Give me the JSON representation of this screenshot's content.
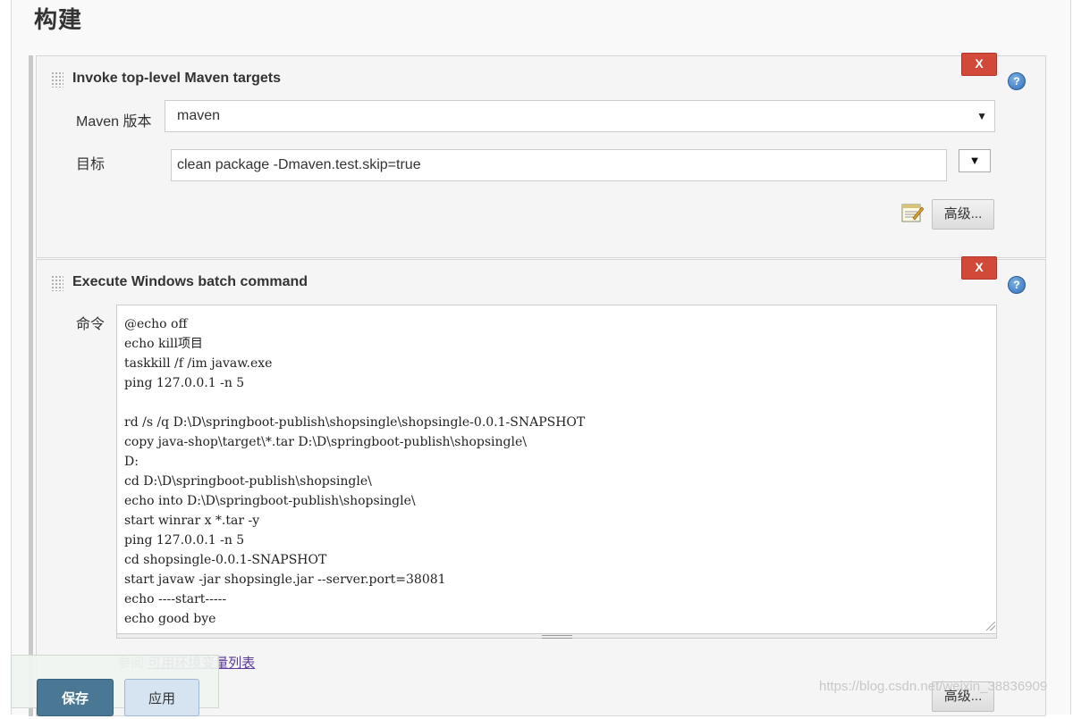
{
  "section": {
    "title": "构建"
  },
  "steps": [
    {
      "title": "Invoke top-level Maven targets",
      "delete_label": "X",
      "help_label": "?",
      "maven_version_label": "Maven 版本",
      "maven_version_value": "maven",
      "select_arrow": "▼",
      "goals_label": "目标",
      "goals_value": "clean package -Dmaven.test.skip=true",
      "expand_label": "▼",
      "advanced_label": "高级..."
    },
    {
      "title": "Execute Windows batch command",
      "delete_label": "X",
      "help_label": "?",
      "command_label": "命令",
      "command_value": "@echo off\necho kill项目\ntaskkill /f /im javaw.exe\nping 127.0.0.1 -n 5\n\nrd /s /q D:\\D\\springboot-publish\\shopsingle\\shopsingle-0.0.1-SNAPSHOT\ncopy java-shop\\target\\*.tar D:\\D\\springboot-publish\\shopsingle\\\nD:\ncd D:\\D\\springboot-publish\\shopsingle\\\necho into D:\\D\\springboot-publish\\shopsingle\\\nstart winrar x *.tar -y\nping 127.0.0.1 -n 5\ncd shopsingle-0.0.1-SNAPSHOT\nstart javaw -jar shopsingle.jar --server.port=38081\necho ----start-----\necho good bye",
      "help_prefix": "参阅",
      "help_link": "可用环境变量列表",
      "advanced_label": "高级..."
    }
  ],
  "bottom_bar": {
    "save_label": "保存",
    "apply_label": "应用"
  },
  "watermark": "https://blog.csdn.net/weixin_38836909",
  "colors": {
    "delete": "#d24939",
    "save": "#4a7894",
    "link": "#5b3d9c"
  },
  "icons": {
    "help": "help-icon",
    "notepad": "notepad-icon",
    "drag": "drag-handle-icon"
  }
}
